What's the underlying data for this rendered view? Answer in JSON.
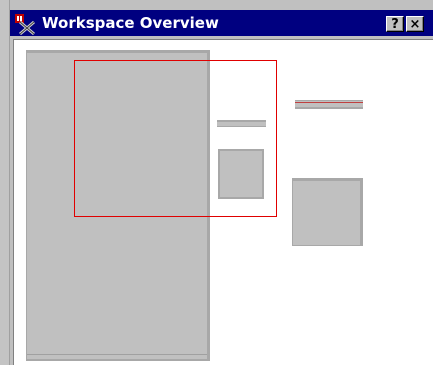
{
  "window": {
    "title": "Workspace Overview",
    "help_button_label": "?",
    "close_button_label": "×",
    "app_icon": "overview-app-icon"
  },
  "colors": {
    "titlebar": "#000080",
    "viewport_outline": "#e00000",
    "thumbnail_fill": "#c0c0c0",
    "client_background": "#ffffff"
  }
}
